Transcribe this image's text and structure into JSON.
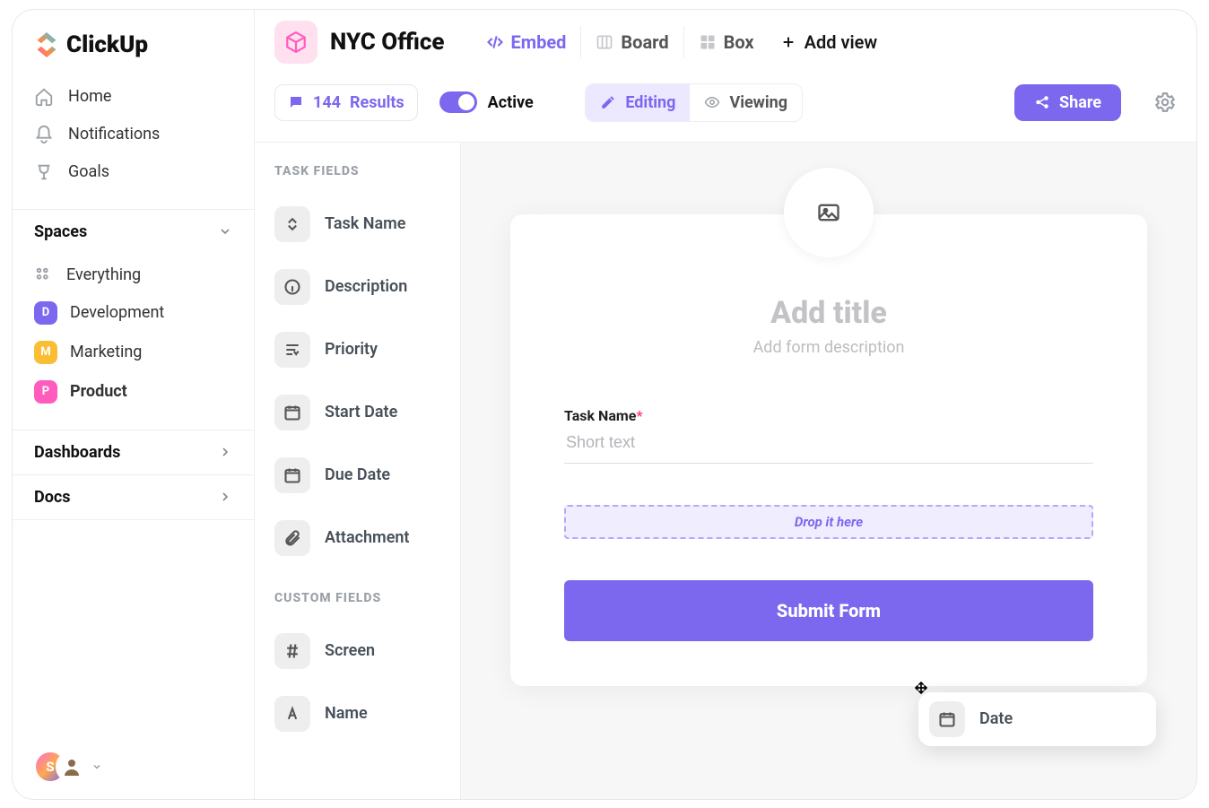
{
  "brand": {
    "name": "ClickUp"
  },
  "nav": {
    "home": "Home",
    "notifications": "Notifications",
    "goals": "Goals"
  },
  "sections": {
    "spaces": "Spaces",
    "dashboards": "Dashboards",
    "docs": "Docs"
  },
  "spaces": {
    "everything": "Everything",
    "items": [
      {
        "letter": "D",
        "label": "Development"
      },
      {
        "letter": "M",
        "label": "Marketing"
      },
      {
        "letter": "P",
        "label": "Product"
      }
    ]
  },
  "user": {
    "initial": "S"
  },
  "project": {
    "title": "NYC Office",
    "views": {
      "embed": "Embed",
      "board": "Board",
      "box": "Box"
    },
    "add_view": "Add view"
  },
  "subbar": {
    "results_count": "144",
    "results_label": "Results",
    "active_label": "Active",
    "editing": "Editing",
    "viewing": "Viewing",
    "share": "Share"
  },
  "fields": {
    "task_head": "Task Fields",
    "custom_head": "Custom Fields",
    "task_name": "Task Name",
    "description": "Description",
    "priority": "Priority",
    "start_date": "Start Date",
    "due_date": "Due Date",
    "attachment": "Attachment",
    "screen": "Screen",
    "name": "Name"
  },
  "dragging": {
    "label": "Date"
  },
  "form": {
    "title_placeholder": "Add title",
    "desc_placeholder": "Add form description",
    "task_name_label": "Task Name",
    "task_name_placeholder": "Short text",
    "drop_hint": "Drop it here",
    "submit": "Submit Form"
  }
}
